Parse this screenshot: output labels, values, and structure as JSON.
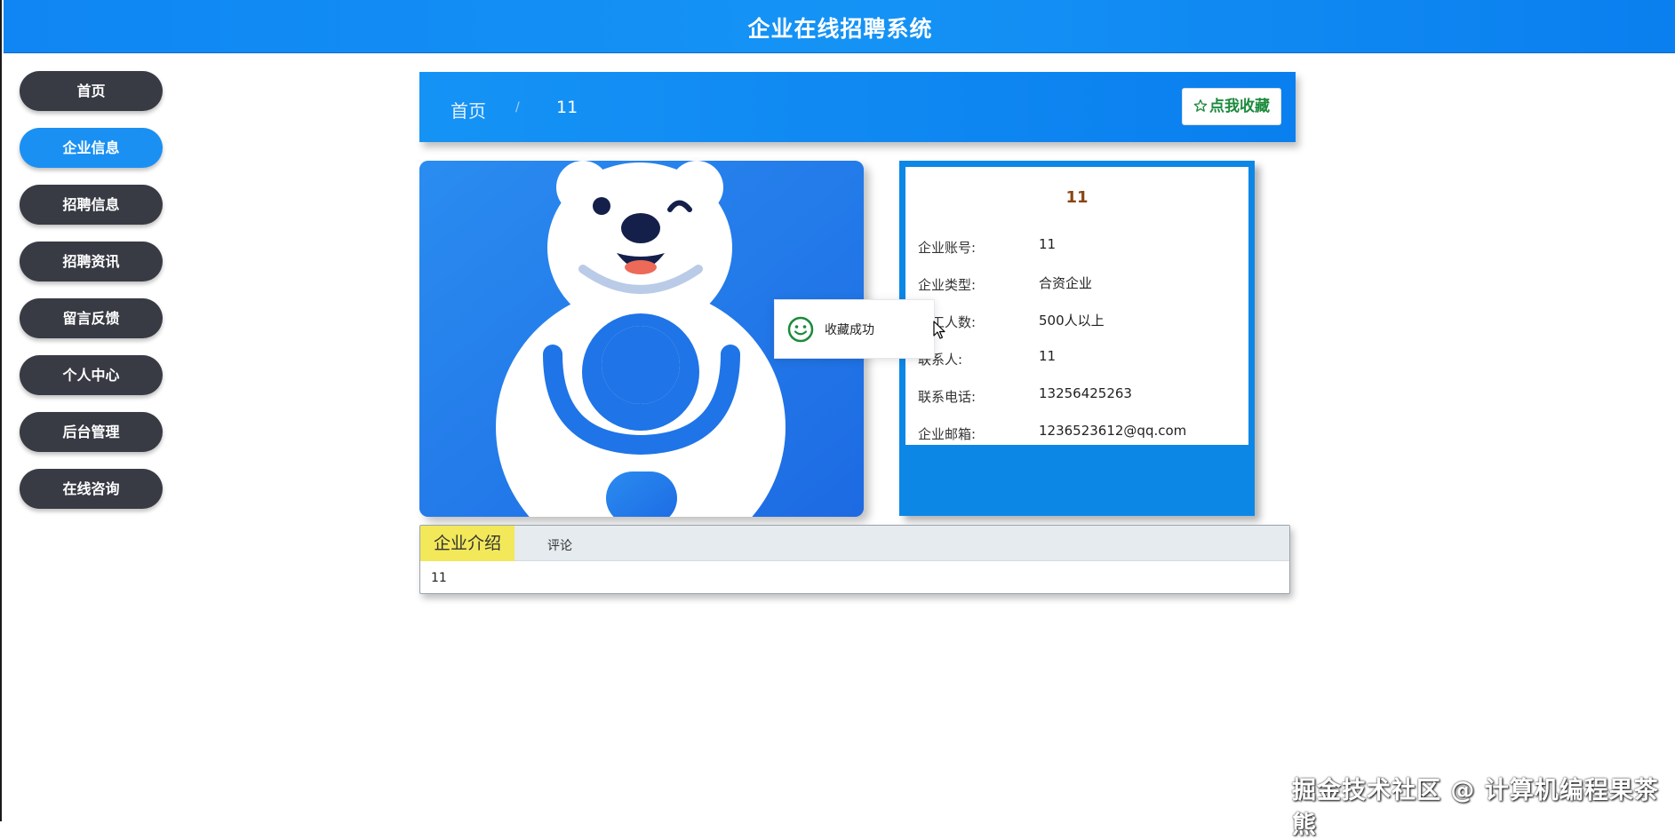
{
  "header": {
    "title": "企业在线招聘系统"
  },
  "nav": {
    "items": [
      {
        "label": "首页"
      },
      {
        "label": "企业信息"
      },
      {
        "label": "招聘信息"
      },
      {
        "label": "招聘资讯"
      },
      {
        "label": "留言反馈"
      },
      {
        "label": "个人中心"
      },
      {
        "label": "后台管理"
      },
      {
        "label": "在线咨询"
      }
    ],
    "active_index": 1
  },
  "breadcrumb": {
    "home": "首页",
    "separator": "/",
    "current": "11",
    "favorite_button": "点我收藏"
  },
  "company": {
    "name": "11",
    "fields": [
      {
        "label": "企业账号:",
        "value": "11"
      },
      {
        "label": "企业类型:",
        "value": "合资企业"
      },
      {
        "label": "员工人数:",
        "value": "500人以上"
      },
      {
        "label": "联系人:",
        "value": "11"
      },
      {
        "label": "联系电话:",
        "value": "13256425263"
      },
      {
        "label": "企业邮箱:",
        "value": "1236523612@qq.com"
      }
    ]
  },
  "toast": {
    "message": "收藏成功"
  },
  "tabs": {
    "intro_label": "企业介绍",
    "comment_label": "评论",
    "content": "11"
  },
  "watermark": "掘金技术社区 @ 计算机编程果茶熊",
  "colors": {
    "primary": "#1593f5",
    "nav_dark": "#383b44",
    "tab_active": "#f2e85a",
    "favorite_text": "#1b8a3b",
    "company_name": "#8b4513"
  },
  "icons": {
    "favorite": "star-outline-icon",
    "toast": "smile-icon",
    "cursor": "mouse-pointer-icon"
  }
}
